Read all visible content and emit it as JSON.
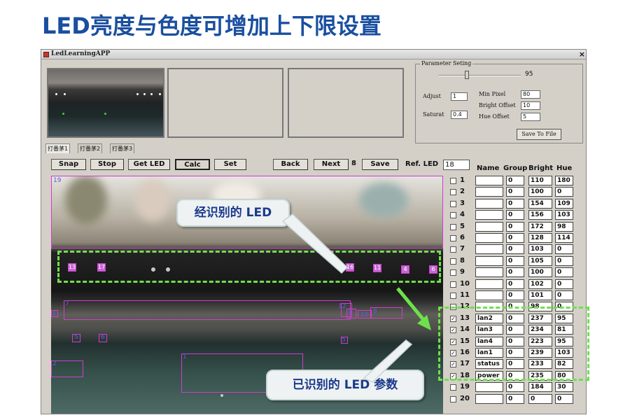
{
  "slide": {
    "title": "LED亮度与色度可增加上下限设置"
  },
  "window": {
    "title": "LedLearningAPP",
    "close_glyph": "×"
  },
  "params": {
    "legend": "Parameter Seting",
    "slider_value": "95",
    "adjust_label": "Adjust",
    "adjust_value": "1",
    "saturat_label": "Saturat",
    "saturat_value": "0.4",
    "minpixel_label": "Min Pixel",
    "minpixel_value": "80",
    "brightoffset_label": "Bright Offset",
    "brightoffset_value": "10",
    "hueoffset_label": "Hue Offset",
    "hueoffset_value": "5",
    "save_to_file": "Save To File"
  },
  "tabs": [
    "打番茅1",
    "打番茅2",
    "打番茅3"
  ],
  "toolbar": {
    "snap": "Snap",
    "stop": "Stop",
    "get_led": "Get LED",
    "calc": "Calc",
    "set": "Set",
    "back": "Back",
    "next": "Next",
    "next_count": "8",
    "save": "Save",
    "ref_led_label": "Ref. LED",
    "ref_led_value": "18"
  },
  "grid_headers": {
    "name": "Name",
    "group": "Group",
    "bright": "Bright",
    "hue": "Hue"
  },
  "rows": [
    {
      "n": "1",
      "checked": false,
      "name": "",
      "group": "0",
      "bright": "110",
      "hue": "180"
    },
    {
      "n": "2",
      "checked": false,
      "name": "",
      "group": "0",
      "bright": "100",
      "hue": "0"
    },
    {
      "n": "3",
      "checked": false,
      "name": "",
      "group": "0",
      "bright": "154",
      "hue": "109"
    },
    {
      "n": "4",
      "checked": false,
      "name": "",
      "group": "0",
      "bright": "156",
      "hue": "103"
    },
    {
      "n": "5",
      "checked": false,
      "name": "",
      "group": "0",
      "bright": "172",
      "hue": "98"
    },
    {
      "n": "6",
      "checked": false,
      "name": "",
      "group": "0",
      "bright": "128",
      "hue": "114"
    },
    {
      "n": "7",
      "checked": false,
      "name": "",
      "group": "0",
      "bright": "103",
      "hue": "0"
    },
    {
      "n": "8",
      "checked": false,
      "name": "",
      "group": "0",
      "bright": "105",
      "hue": "0"
    },
    {
      "n": "9",
      "checked": false,
      "name": "",
      "group": "0",
      "bright": "100",
      "hue": "0"
    },
    {
      "n": "10",
      "checked": false,
      "name": "",
      "group": "0",
      "bright": "102",
      "hue": "0"
    },
    {
      "n": "11",
      "checked": false,
      "name": "",
      "group": "0",
      "bright": "101",
      "hue": "0"
    },
    {
      "n": "12",
      "checked": false,
      "name": "",
      "group": "0",
      "bright": "98",
      "hue": "0"
    },
    {
      "n": "13",
      "checked": true,
      "name": "lan2",
      "group": "0",
      "bright": "237",
      "hue": "95"
    },
    {
      "n": "14",
      "checked": true,
      "name": "lan3",
      "group": "0",
      "bright": "234",
      "hue": "81"
    },
    {
      "n": "15",
      "checked": true,
      "name": "lan4",
      "group": "0",
      "bright": "223",
      "hue": "95"
    },
    {
      "n": "16",
      "checked": true,
      "name": "lan1",
      "group": "0",
      "bright": "239",
      "hue": "103"
    },
    {
      "n": "17",
      "checked": true,
      "name": "status",
      "group": "0",
      "bright": "233",
      "hue": "82"
    },
    {
      "n": "18",
      "checked": true,
      "name": "power",
      "group": "0",
      "bright": "235",
      "hue": "80"
    },
    {
      "n": "19",
      "checked": false,
      "name": "",
      "group": "0",
      "bright": "184",
      "hue": "30"
    },
    {
      "n": "20",
      "checked": false,
      "name": "",
      "group": "0",
      "bright": "0",
      "hue": "0"
    }
  ],
  "roi_labels": [
    "19",
    "13",
    "17",
    "16",
    "11",
    "4",
    "6",
    "7",
    "12",
    "9",
    "10",
    "8",
    "3",
    "5",
    "6",
    "5",
    "2",
    "1"
  ],
  "callouts": {
    "recognized_led": "经识别的 LED",
    "recognized_params": "已识别的 LED 参数"
  },
  "colors": {
    "title_blue": "#1a4fa0",
    "roi_magenta": "#d13cd1",
    "highlight_green": "#6ee14a"
  }
}
